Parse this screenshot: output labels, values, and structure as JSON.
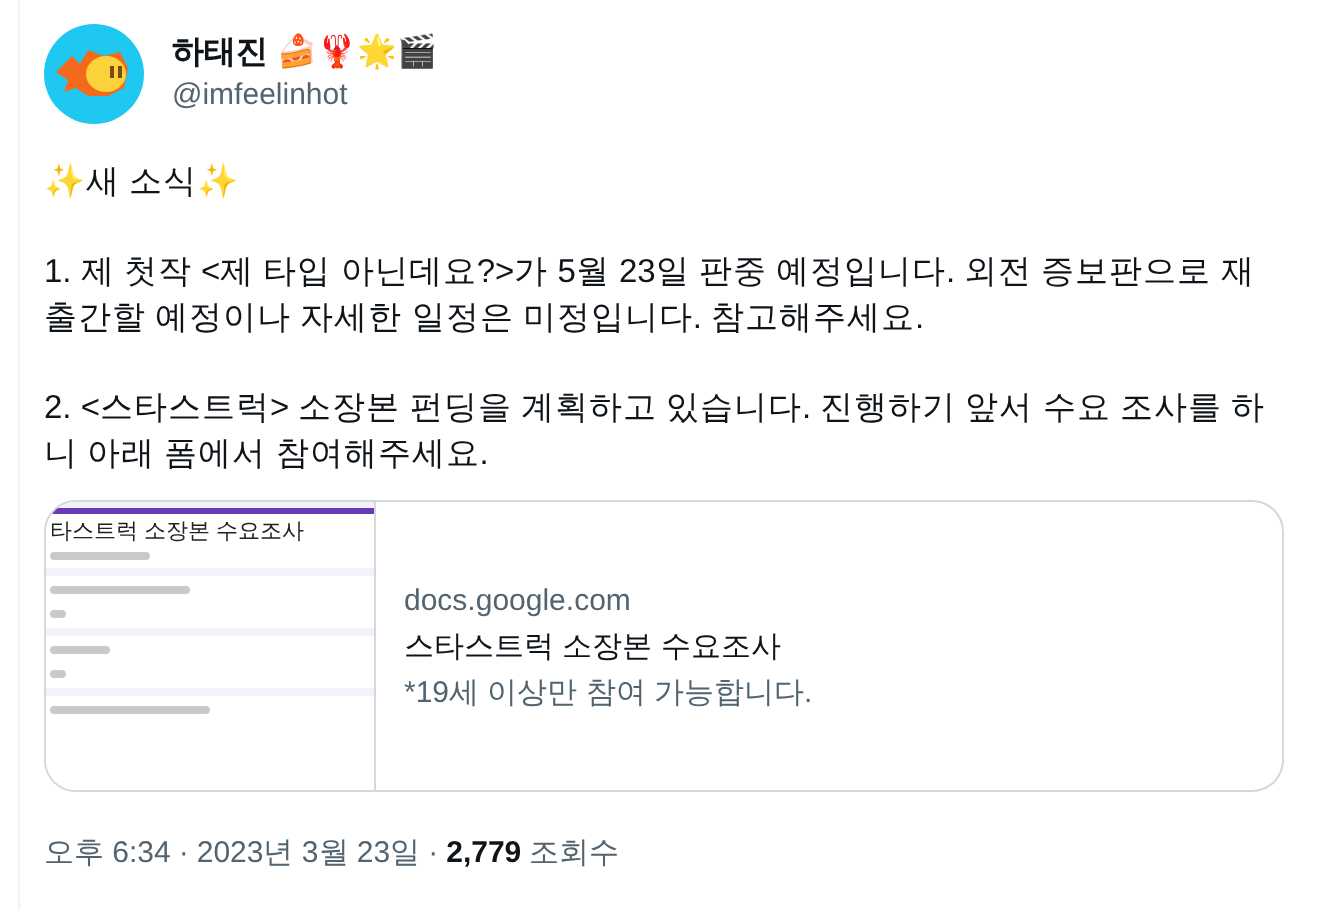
{
  "author": {
    "name": "하태진 🍰🦞🌟🎬",
    "handle": "@imfeelinhot"
  },
  "body": [
    "✨새 소식✨",
    "1. 제 첫작 <제 타입 아닌데요?>가 5월 23일 판중 예정입니다. 외전 증보판으로 재출간할 예정이나 자세한 일정은 미정입니다. 참고해주세요.",
    "2. <스타스트럭> 소장본 펀딩을 계획하고 있습니다. 진행하기 앞서 수요 조사를 하니 아래 폼에서 참여해주세요."
  ],
  "card": {
    "thumbnail_title": "타스트럭 소장본 수요조사",
    "domain": "docs.google.com",
    "title": "스타스트럭 소장본 수요조사",
    "description": "*19세 이상만 참여 가능합니다."
  },
  "meta": {
    "time": "오후 6:34",
    "separator": "·",
    "date": "2023년 3월 23일",
    "views": "2,779",
    "views_label": "조회수"
  }
}
